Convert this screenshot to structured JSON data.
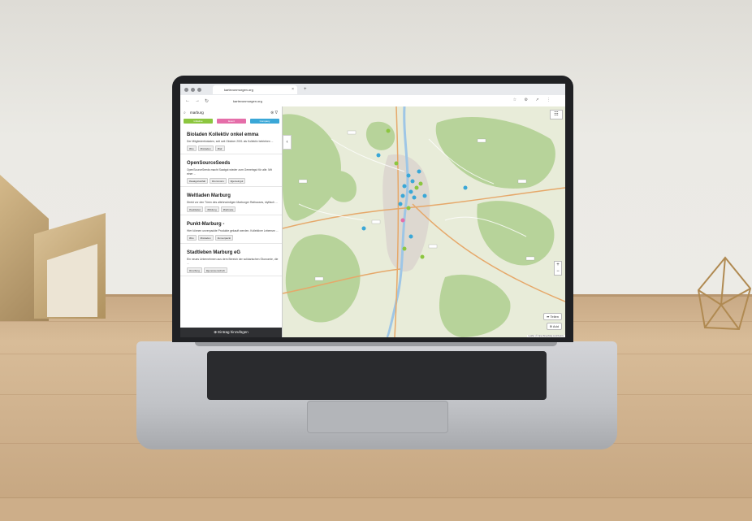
{
  "browser": {
    "tab_title": "kartevonmorgen.org",
    "url": "kartevonmorgen.org",
    "new_tab": "+"
  },
  "sidebar": {
    "search_value": "marburg",
    "filters": [
      {
        "label": "Initiative",
        "color": "#8cc63f"
      },
      {
        "label": "Event",
        "color": "#e56ea9"
      },
      {
        "label": "Company",
        "color": "#3aa7d7"
      }
    ],
    "entries": [
      {
        "title": "Bioladen Kollektiv onkel emma",
        "desc": "Der Mitgliederbioladen, seit seit Oktober 2001 als Kollektiv betrieben ...",
        "tags": [
          "#bio",
          "#bioladen",
          "#fair"
        ]
      },
      {
        "title": "OpenSourceSeeds",
        "desc": "OpenSourceSeeds macht Saatgut wieder zum Gemeingut für alle. Mit einer ...",
        "tags": [
          "#saatgutvielfalt",
          "#commons",
          "#gemeingut"
        ]
      },
      {
        "title": "Weltladen Marburg",
        "desc": "Direkt vor den Türen des altehrwürdigen Marburger Rathauses, idyllisch ...",
        "tags": [
          "#weltladen",
          "#bildung",
          "#fairtrade"
        ]
      },
      {
        "title": "Punkt-Marburg -",
        "desc": "Hier können unverpackte Produkte gekauft werden. Kollektiver Lebensm ...",
        "tags": [
          "#bio",
          "#bioladen",
          "#unverpackt"
        ]
      },
      {
        "title": "Stadtleben Marburg eG",
        "desc": "Ein neues Unternehmen aus dem Bereich der solidarischen Ökonomie, die ...",
        "tags": [
          "#marburg",
          "#genossenschaft"
        ]
      }
    ],
    "add_entry": "Eintrag hinzufügen"
  },
  "map": {
    "zoom_in": "+",
    "zoom_out": "−",
    "share_label": "Teilen",
    "add_label": "Add",
    "attribution": "Leaflet | © OpenStreetMap contributors"
  }
}
